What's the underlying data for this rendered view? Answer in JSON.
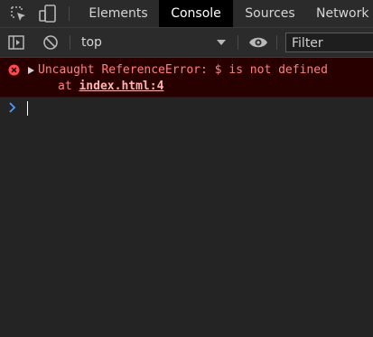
{
  "tabbar": {
    "tabs": [
      {
        "label": "Elements"
      },
      {
        "label": "Console",
        "active": true
      },
      {
        "label": "Sources"
      },
      {
        "label": "Network"
      }
    ]
  },
  "toolbar": {
    "context": "top",
    "filter_placeholder": "Filter"
  },
  "console": {
    "messages": [
      {
        "level": "error",
        "text": "Uncaught ReferenceError: $ is not defined",
        "at_prefix": "at",
        "location": "index.html:4"
      }
    ],
    "prompt_symbol": "›"
  },
  "colors": {
    "error_bg": "#290000",
    "error_text": "#ff8080",
    "prompt_blue": "#4d9bff"
  }
}
